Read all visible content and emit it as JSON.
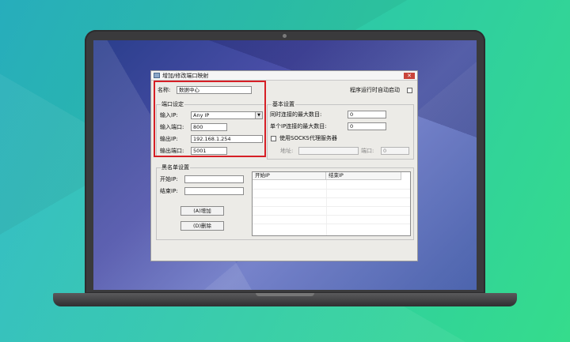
{
  "dialog": {
    "title": "增加/修改端口映射",
    "close_glyph": "✕",
    "name_label": "名称:",
    "name_value": "数据中心",
    "autostart_label": "程序运行时自动启动"
  },
  "port_settings": {
    "title": "端口设定",
    "input_ip_label": "输入IP:",
    "input_ip_value": "Any IP",
    "input_ip_arrow": "▼",
    "input_port_label": "输入端口:",
    "input_port_value": "800",
    "output_ip_label": "输出IP:",
    "output_ip_value": "192.168.1.254",
    "output_port_label": "输出端口:",
    "output_port_value": "5001"
  },
  "basic_settings": {
    "title": "基本设置",
    "max_conn_label": "同时连接的最大数目:",
    "max_conn_value": "0",
    "max_conn_per_ip_label": "单个IP连接的最大数目:",
    "max_conn_per_ip_value": "0",
    "socks_label": "使用SOCKS代理服务器",
    "address_label": "地址:",
    "address_value": "",
    "port_label": "端口:",
    "port_value": "0"
  },
  "blacklist": {
    "title": "黑名单设置",
    "start_ip_label": "开始IP:",
    "start_ip_value": "",
    "end_ip_label": "结束IP:",
    "end_ip_value": "",
    "add_button": "(A)增加",
    "delete_button": "(D)删除",
    "columns": [
      "开始IP",
      "结束IP"
    ]
  },
  "colors": {
    "highlight": "#d61f26",
    "background_start": "#29b6c6",
    "background_end": "#35dc8c"
  }
}
